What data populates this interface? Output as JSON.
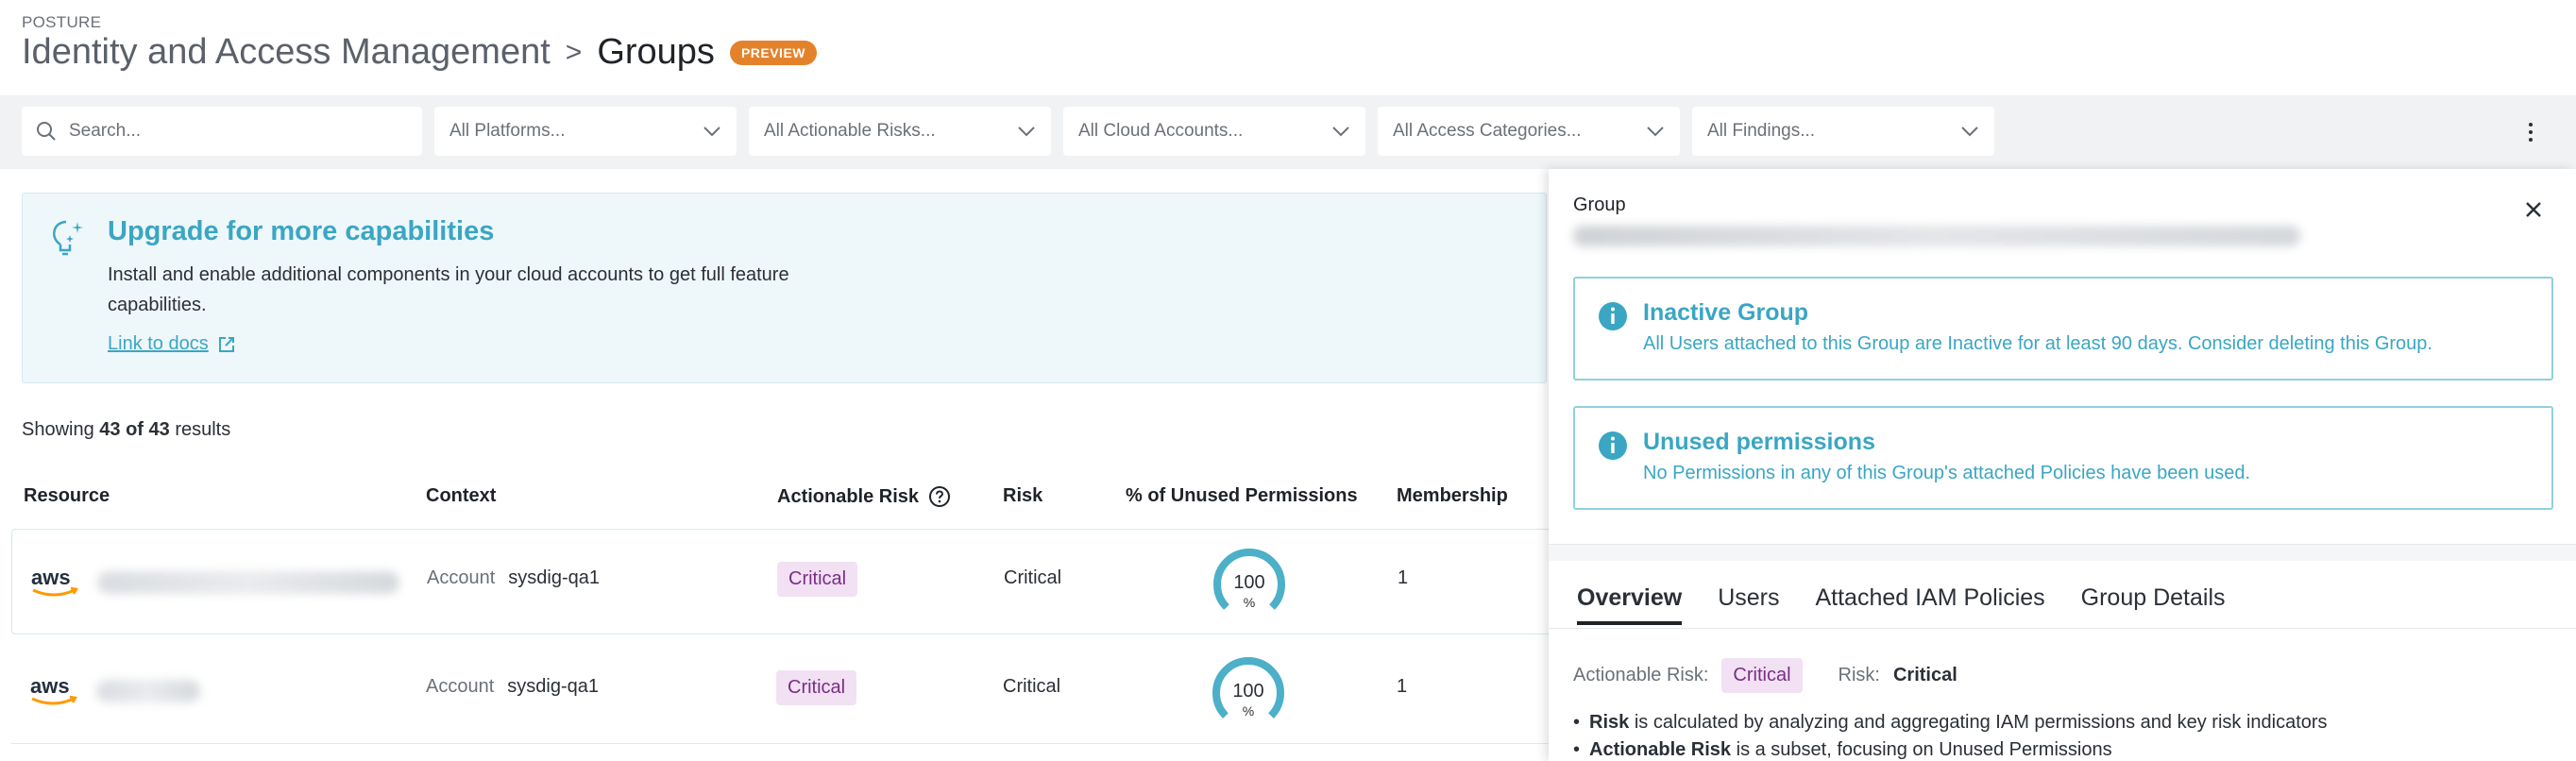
{
  "header": {
    "eyebrow": "POSTURE",
    "section": "Identity and Access Management",
    "separator": ">",
    "current": "Groups",
    "badge": "PREVIEW"
  },
  "filters": {
    "search_placeholder": "Search...",
    "dropdowns": [
      "All Platforms...",
      "All Actionable Risks...",
      "All Cloud Accounts...",
      "All Access Categories...",
      "All Findings..."
    ]
  },
  "banner": {
    "title": "Upgrade for more capabilities",
    "text": "Install and enable additional components in your cloud accounts to get full feature capabilities.",
    "link": "Link to docs"
  },
  "results": {
    "prefix": "Showing",
    "count": "43 of 43",
    "suffix": "results"
  },
  "table": {
    "columns": [
      "Resource",
      "Context",
      "Actionable Risk",
      "Risk",
      "% of Unused Permissions",
      "Membership"
    ],
    "rows": [
      {
        "context_label": "Account",
        "context_value": "sysdig-qa1",
        "actionable_risk": "Critical",
        "risk": "Critical",
        "unused_pct": 100,
        "unused_value": "100",
        "unused_unit": "%",
        "membership": "1"
      },
      {
        "context_label": "Account",
        "context_value": "sysdig-qa1",
        "actionable_risk": "Critical",
        "risk": "Critical",
        "unused_pct": 100,
        "unused_value": "100",
        "unused_unit": "%",
        "membership": "1"
      }
    ]
  },
  "drawer": {
    "label": "Group",
    "cards": [
      {
        "title": "Inactive Group",
        "text": "All Users attached to this Group are Inactive for at least 90 days. Consider deleting this Group."
      },
      {
        "title": "Unused permissions",
        "text": "No Permissions in any of this Group's attached Policies have been used."
      }
    ],
    "tabs": [
      "Overview",
      "Users",
      "Attached IAM Policies",
      "Group Details"
    ],
    "actionable_risk_label": "Actionable Risk:",
    "actionable_risk_value": "Critical",
    "risk_label": "Risk:",
    "risk_value": "Critical",
    "bullets": [
      {
        "bold": "Risk",
        "text": " is calculated by analyzing and aggregating IAM permissions and key risk indicators"
      },
      {
        "bold": "Actionable Risk",
        "text": " is a subset, focusing on Unused Permissions"
      }
    ]
  },
  "colors": {
    "accent": "#3aa6c3",
    "preview_badge": "#e4822b",
    "critical_bg": "#f1e1f3",
    "critical_text": "#7b2d86"
  }
}
